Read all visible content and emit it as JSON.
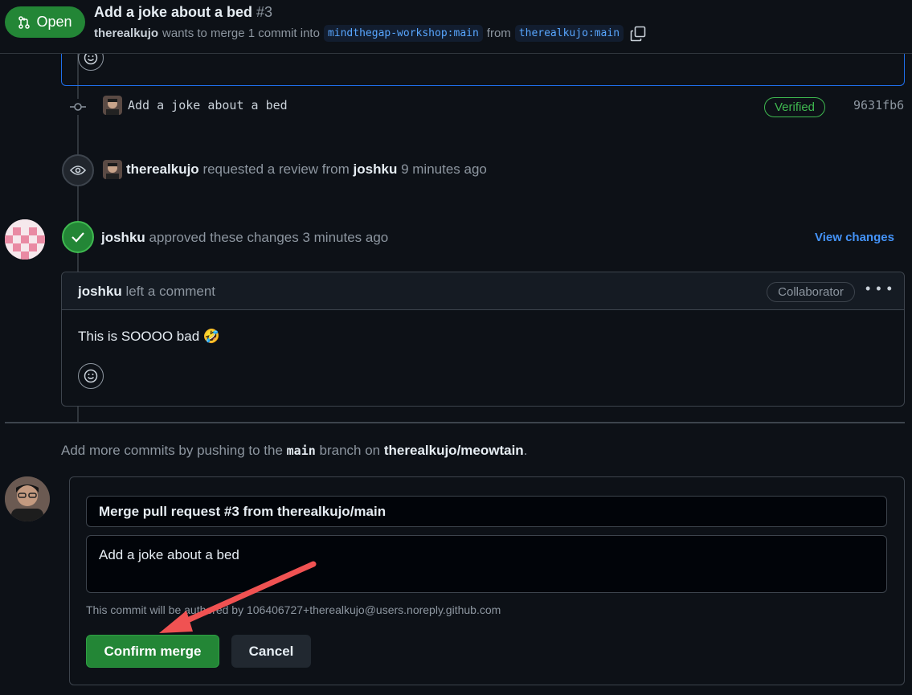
{
  "header": {
    "status_label": "Open",
    "title": "Add a joke about a bed",
    "number": "#3",
    "author": "therealkujo",
    "wants_text": "wants to merge 1 commit into",
    "base_branch": "mindthegap-workshop:main",
    "from_text": "from",
    "head_branch": "therealkujo:main"
  },
  "commit": {
    "message": "Add a joke about a bed",
    "verified_label": "Verified",
    "sha": "9631fb6"
  },
  "review_request": {
    "actor": "therealkujo",
    "text": "requested a review from",
    "reviewer": "joshku",
    "time": "9 minutes ago"
  },
  "approval": {
    "actor": "joshku",
    "text": "approved these changes 3 minutes ago",
    "view_changes_label": "View changes"
  },
  "comment": {
    "author": "joshku",
    "header_text": "left a comment",
    "badge": "Collaborator",
    "body": "This is SOOOO bad 🤣"
  },
  "add_commits": {
    "prefix": "Add more commits by pushing to the",
    "branch": "main",
    "middle": "branch on",
    "repo": "therealkujo/meowtain",
    "suffix": "."
  },
  "merge_form": {
    "title_value": "Merge pull request #3 from therealkujo/main",
    "body_value": "Add a joke about a bed",
    "author_note": "This commit will be authored by 106406727+therealkujo@users.noreply.github.com",
    "confirm_label": "Confirm merge",
    "cancel_label": "Cancel"
  },
  "colors": {
    "accent_green": "#238636",
    "link_blue": "#4493f8",
    "annotation_arrow": "#f05252"
  },
  "icons": [
    "git-pull-request-icon",
    "copy-icon",
    "smiley-icon",
    "git-commit-icon",
    "eye-icon",
    "check-icon",
    "kebab-icon"
  ]
}
